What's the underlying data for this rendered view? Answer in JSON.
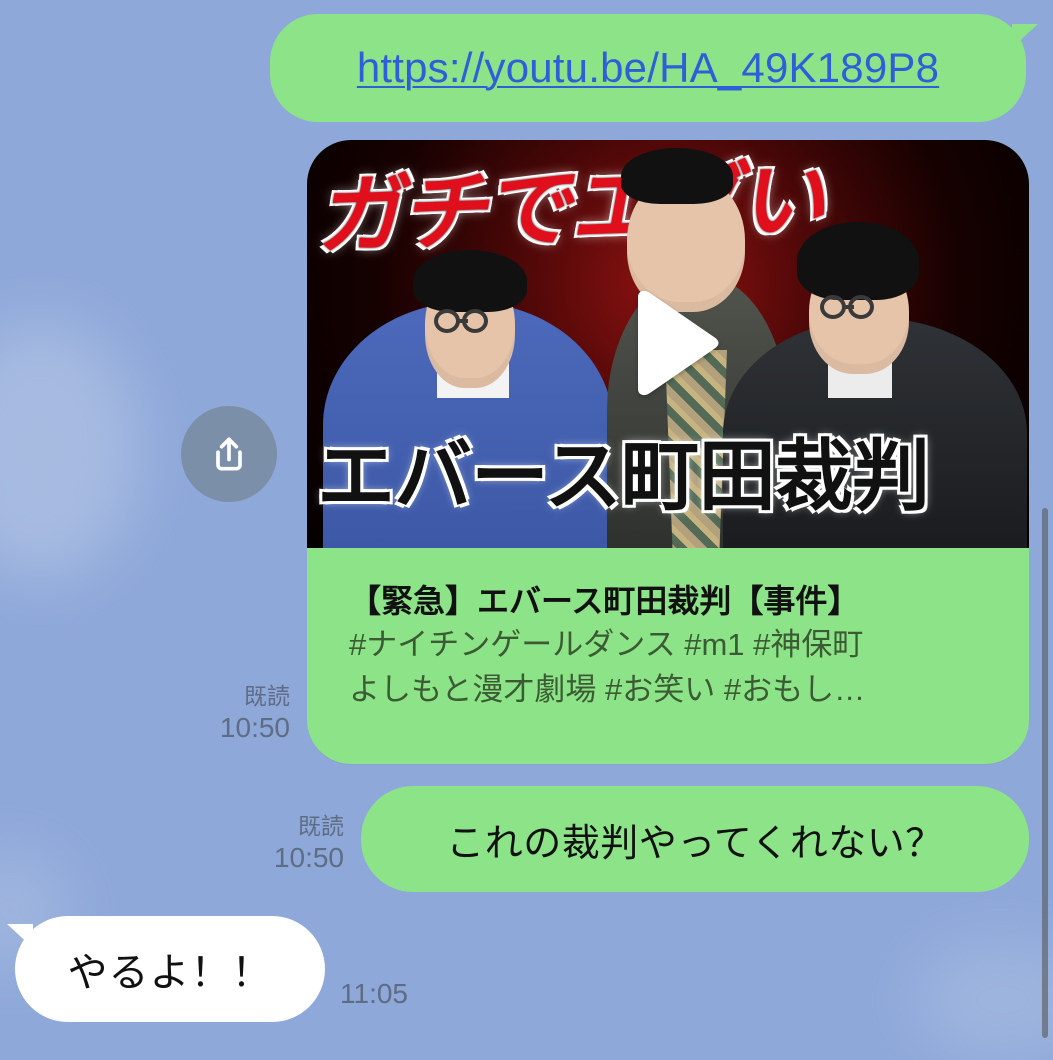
{
  "chat": {
    "url_message": {
      "text": "https://youtu.be/HA_49K189P8"
    },
    "preview": {
      "thumbnail_top_text": "ガチでエグい",
      "thumbnail_bottom_text": "エバース町田裁判",
      "title": "【緊急】エバース町田裁判【事件】",
      "description_lines": [
        "#ナイチンゲールダンス #m1 #神保町",
        "よしもと漫才劇場 #お笑い #おもし…"
      ],
      "read_label": "既読",
      "time": "10:50",
      "share_icon": "share-icon",
      "play_icon": "play-icon"
    },
    "question_message": {
      "text": "これの裁判やってくれない？",
      "read_label": "既読",
      "time": "10:50"
    },
    "reply_message": {
      "text": "やるよ！！",
      "time": "11:05"
    }
  },
  "colors": {
    "background": "#8ea8d9",
    "sent_bubble": "#8de387",
    "received_bubble": "#ffffff",
    "link": "#2f5fd8",
    "meta_text": "#5f6d84"
  }
}
